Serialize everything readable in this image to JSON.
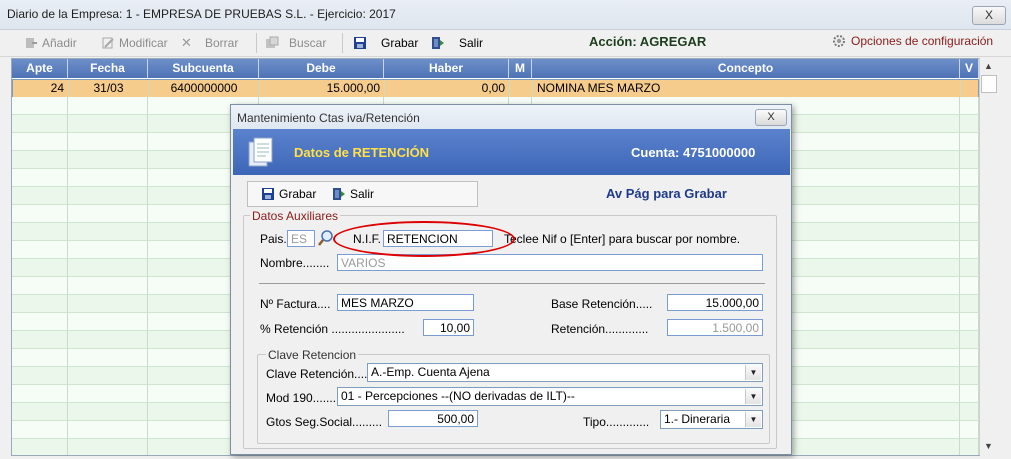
{
  "window": {
    "title": "Diario de la Empresa: 1 - EMPRESA DE PRUEBAS S.L.   - Ejercicio: 2017",
    "close": "X"
  },
  "toolbar": {
    "add": "Añadir",
    "modify": "Modificar",
    "delete": "Borrar",
    "search": "Buscar",
    "save": "Grabar",
    "exit": "Salir",
    "action": "Acción: AGREGAR",
    "options": "Opciones de configuración"
  },
  "grid": {
    "headers": [
      "Apte",
      "Fecha",
      "Subcuenta",
      "Debe",
      "Haber",
      "M",
      "Concepto",
      "V"
    ],
    "rows": [
      [
        "24",
        "31/03",
        "6400000000",
        "15.000,00",
        "0,00",
        "",
        "NOMINA MES MARZO",
        ""
      ]
    ]
  },
  "dialog": {
    "title": "Mantenimiento Ctas iva/Retención",
    "close": "X",
    "banner_title": "Datos de RETENCIÓN",
    "account": "Cuenta: 4751000000",
    "save": "Grabar",
    "exit": "Salir",
    "hint": "Av Pág para Grabar",
    "aux_legend": "Datos Auxiliares",
    "pais_label": "Pais.",
    "pais_value": "ES",
    "nif_label": "N.I.F.",
    "nif_value": "RETENCION",
    "nif_hint": "Teclee Nif o [Enter] para buscar por nombre.",
    "nombre_label": "Nombre........",
    "nombre_value": "VARIOS",
    "factura_label": "Nº Factura....",
    "factura_value": "MES MARZO",
    "base_label": "Base Retención.....",
    "base_value": "15.000,00",
    "pct_label": "% Retención ......................",
    "pct_value": "10,00",
    "ret_label": "Retención.............",
    "ret_value": "1.500,00",
    "clave_legend": "Clave Retencion",
    "clave_label": "Clave Retención....",
    "clave_value": "A.-Emp. Cuenta Ajena",
    "mod_label": "Mod 190.......",
    "mod_value": "01 - Percepciones --(NO derivadas de ILT)--",
    "gtos_label": "Gtos Seg.Social.........",
    "gtos_value": "500,00",
    "tipo_label": "Tipo.............",
    "tipo_value": "1.- Dineraria"
  },
  "colors": {
    "header_blue": "#5a7dc0",
    "selected_row": "#f6cc8c",
    "banner_yellow": "#ffe04a",
    "highlight_red": "#dd0000"
  },
  "icons": [
    "add-icon",
    "modify-icon",
    "delete-icon",
    "search-icon",
    "save-icon",
    "exit-icon",
    "gear-icon",
    "document-icon",
    "magnifier-icon"
  ]
}
